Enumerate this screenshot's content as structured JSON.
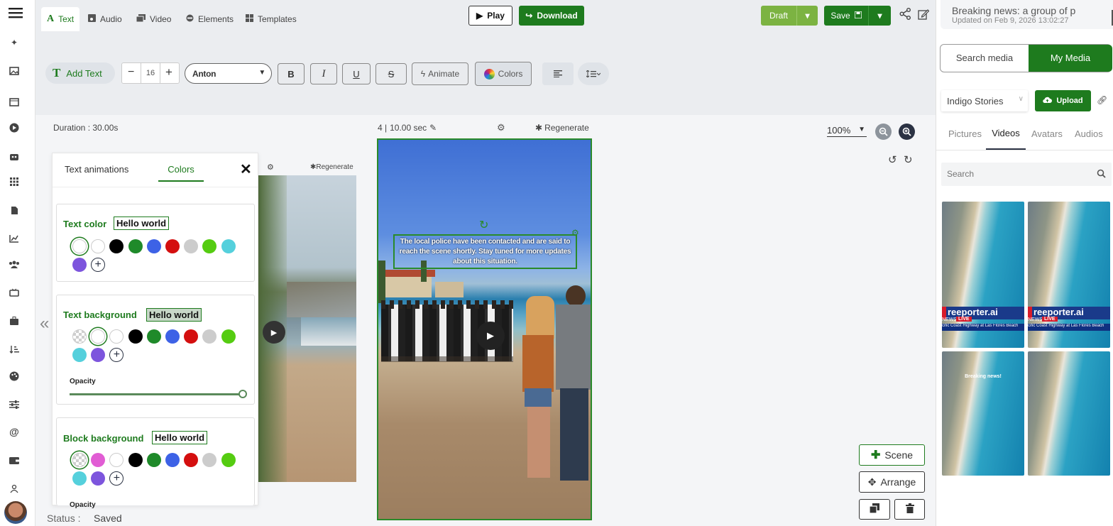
{
  "left_sidebar": {
    "icons": [
      "menu-icon",
      "sparkle-icon",
      "image-icon",
      "film-icon",
      "play-circle-icon",
      "robot-icon",
      "grid-icon",
      "document-icon",
      "chart-icon",
      "users-icon",
      "tv-icon",
      "briefcase-icon",
      "sort-icon",
      "palette-icon",
      "sliders-icon",
      "at-icon",
      "wallet-icon",
      "person-icon",
      "avatar"
    ]
  },
  "toolbar": {
    "tabs": [
      {
        "label": "Text"
      },
      {
        "label": "Audio"
      },
      {
        "label": "Video"
      },
      {
        "label": "Elements"
      },
      {
        "label": "Templates"
      }
    ],
    "play_label": "Play",
    "download_label": "Download",
    "draft_label": "Draft",
    "save_label": "Save"
  },
  "project": {
    "title": "Breaking news: a group of p",
    "updated": "Updated on Feb 9, 2026 13:02:27"
  },
  "text_tools": {
    "add_text": "Add Text",
    "font_size": "16",
    "font_name": "Anton",
    "bold": "B",
    "italic": "I",
    "underline": "U",
    "strike": "S",
    "animate": "Animate",
    "colors": "Colors"
  },
  "editor": {
    "duration": "Duration : 30.00s",
    "scene_number": "4 |",
    "scene_duration": "10.00 sec",
    "regenerate": "Regenerate",
    "regenerate_small": "Regenerate",
    "zoom": "100%",
    "caption": "The local police have been contacted and are said to reach the scene shortly. Stay tuned for more updates about this situation.",
    "scene_button": "Scene",
    "arrange_button": "Arrange",
    "status_label": "Status :",
    "status_value": "Saved"
  },
  "colors_panel": {
    "tab_animations": "Text animations",
    "tab_colors": "Colors",
    "text_color": {
      "title": "Text color",
      "preview": "Hello world",
      "swatches": [
        "#ffffff",
        "#ffffff",
        "#000000",
        "#1f8a2a",
        "#3d62e6",
        "#d40f0f",
        "#cccccc",
        "#55cc11",
        "#55d0dc",
        "#7d55dd"
      ]
    },
    "text_background": {
      "title": "Text background",
      "preview": "Hello world",
      "opacity_label": "Opacity",
      "opacity": 1.0,
      "swatches": [
        "transparent",
        "#ffffff",
        "#ffffff",
        "#000000",
        "#1f8a2a",
        "#3d62e6",
        "#d40f0f",
        "#cccccc",
        "#55cc11",
        "#55d0dc",
        "#7d55dd"
      ]
    },
    "block_background": {
      "title": "Block background",
      "preview": "Hello world",
      "opacity_label": "Opacity",
      "swatches": [
        "transparent",
        "#e15dd4",
        "#ffffff",
        "#000000",
        "#1f8a2a",
        "#3d62e6",
        "#d40f0f",
        "#cccccc",
        "#55cc11",
        "#55d0dc",
        "#7d55dd"
      ]
    }
  },
  "media_panel": {
    "search_media": "Search media",
    "my_media": "My Media",
    "folder": "Indigo Stories",
    "upload": "Upload",
    "tabs": [
      {
        "label": "Pictures"
      },
      {
        "label": "Videos"
      },
      {
        "label": "Avatars"
      },
      {
        "label": "Audios"
      }
    ],
    "search_placeholder": "Search",
    "thumbs": [
      {
        "brand": "reeporter.ai",
        "live": "LIVE",
        "news": "NEWS",
        "ticker": "cific Coast Highway at Las Flores Beach"
      },
      {
        "brand": "reeporter.ai",
        "live": "LIVE",
        "news": "NEWS",
        "ticker": "cific Coast Highway at Las Flores Beach"
      },
      {
        "headline": "Breaking news!"
      },
      {}
    ]
  },
  "colors": {
    "brand_green": "#1e7b1e",
    "draft_green": "#7cb342",
    "accent_blue": "#3b5998"
  }
}
